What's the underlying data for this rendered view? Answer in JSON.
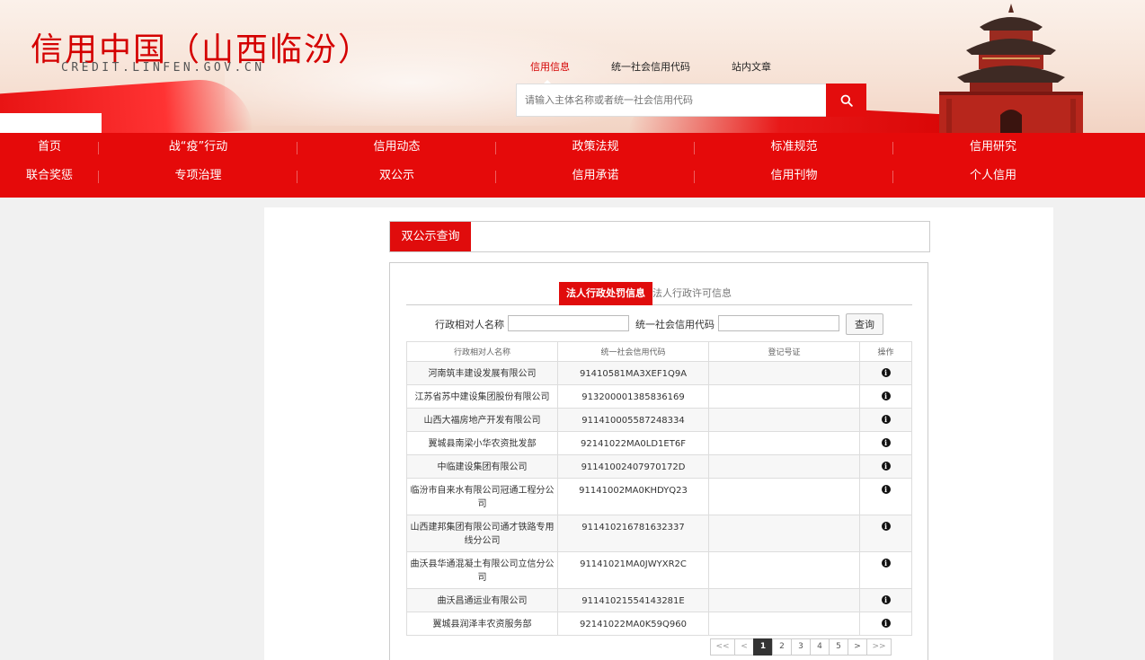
{
  "site": {
    "title": "信用中国（山西临汾）",
    "subtitle": "CREDIT.LINFEN.GOV.CN"
  },
  "search": {
    "tabs": [
      "信用信息",
      "统一社会信用代码",
      "站内文章"
    ],
    "active_tab": "信用信息",
    "placeholder": "请输入主体名称或者统一社会信用代码",
    "button_icon": "search-icon"
  },
  "nav": {
    "row1": [
      "首页",
      "战“疫”行动",
      "信用动态",
      "政策法规",
      "标准规范",
      "信用研究"
    ],
    "row2": [
      "联合奖惩",
      "专项治理",
      "双公示",
      "信用承诺",
      "信用刊物",
      "个人信用"
    ]
  },
  "section": {
    "title": "双公示查询"
  },
  "sub_tabs": {
    "active": "法人行政处罚信息",
    "inactive": "法人行政许可信息"
  },
  "filter": {
    "name_label": "行政相对人名称",
    "code_label": "统一社会信用代码",
    "button": "查询"
  },
  "table": {
    "headers": [
      "行政相对人名称",
      "统一社会信用代码",
      "登记号证",
      "操作"
    ],
    "rows": [
      [
        "河南筑丰建设发展有限公司",
        "91410581MA3XEF1Q9A",
        ""
      ],
      [
        "江苏省苏中建设集团股份有限公司",
        "913200001385836169",
        ""
      ],
      [
        "山西大福房地产开发有限公司",
        "911410005587248334",
        ""
      ],
      [
        "翼城县南梁小华农资批发部",
        "92141022MA0LD1ET6F",
        ""
      ],
      [
        "中临建设集团有限公司",
        "91141002407970172D",
        ""
      ],
      [
        "临汾市自来水有限公司冠通工程分公司",
        "91141002MA0KHDYQ23",
        ""
      ],
      [
        "山西建邦集团有限公司通才铁路专用线分公司",
        "911410216781632337",
        ""
      ],
      [
        "曲沃县华通混凝土有限公司立信分公司",
        "91141021MA0JWYXR2C",
        ""
      ],
      [
        "曲沃昌通运业有限公司",
        "91141021554143281E",
        ""
      ],
      [
        "翼城县润泽丰农资服务部",
        "92141022MA0K59Q960",
        ""
      ]
    ],
    "action_icon": "info-icon"
  },
  "pager": {
    "first": "<<",
    "prev": "<",
    "pages": [
      "1",
      "2",
      "3",
      "4",
      "5"
    ],
    "current": "1",
    "next": ">",
    "last": ">>"
  },
  "colors": {
    "brand_red": "#e50a0a",
    "tab_red": "#e00c0c"
  }
}
